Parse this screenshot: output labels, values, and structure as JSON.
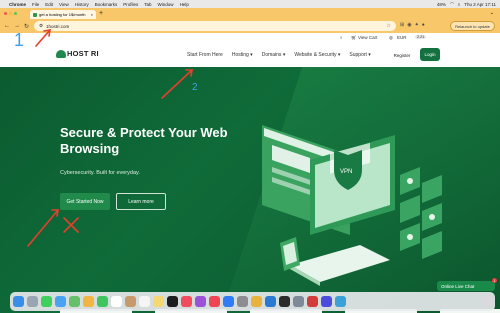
{
  "menubar": {
    "app": "Chrome",
    "items": [
      "File",
      "Edit",
      "View",
      "History",
      "Bookmarks",
      "Profiles",
      "Tab",
      "Window",
      "Help"
    ],
    "clock": "Thu 2 Apr 17:11",
    "battery": "48%"
  },
  "browser": {
    "tab_title": "get a hosting for 1$/month",
    "url": "1hostri.com",
    "relaunch_label": "Relaunch to update"
  },
  "site": {
    "topbar": {
      "view_cart": "View Cart",
      "currency": "EUR",
      "badge": "2.21"
    },
    "logo_text": "HOST RI",
    "nav": [
      {
        "label": "Start From Here"
      },
      {
        "label": "Hosting ▾"
      },
      {
        "label": "Domains ▾"
      },
      {
        "label": "Website & Security ▾"
      },
      {
        "label": "Support ▾"
      }
    ],
    "register": "Register",
    "login": "Login",
    "hero": {
      "title": "Secure & Protect Your Web Browsing",
      "subtitle": "Cybersecurity. Built for everyday.",
      "primary_button": "Get Started Now",
      "secondary_button": "Learn more"
    },
    "livechat": {
      "label": "Online Live Chat",
      "count": "1"
    }
  },
  "annotations": {
    "number_1": "1",
    "number_2": "2",
    "color": "#e5402b"
  },
  "colors": {
    "brand_green": "#12713e",
    "hero_bg": "#0c5b30",
    "chrome_frame": "#f7c76a"
  },
  "dock": {
    "apps": [
      "finder-icon",
      "launchpad-icon",
      "messages-icon",
      "mail-icon",
      "maps-icon",
      "photos-icon",
      "facetime-icon",
      "calendar-icon",
      "contacts-icon",
      "reminders-icon",
      "notes-icon",
      "tv-icon",
      "music-icon",
      "podcasts-icon",
      "news-icon",
      "appstore-icon",
      "settings-icon",
      "chrome-icon",
      "vscode-icon",
      "terminal-icon",
      "trash-icon"
    ]
  }
}
